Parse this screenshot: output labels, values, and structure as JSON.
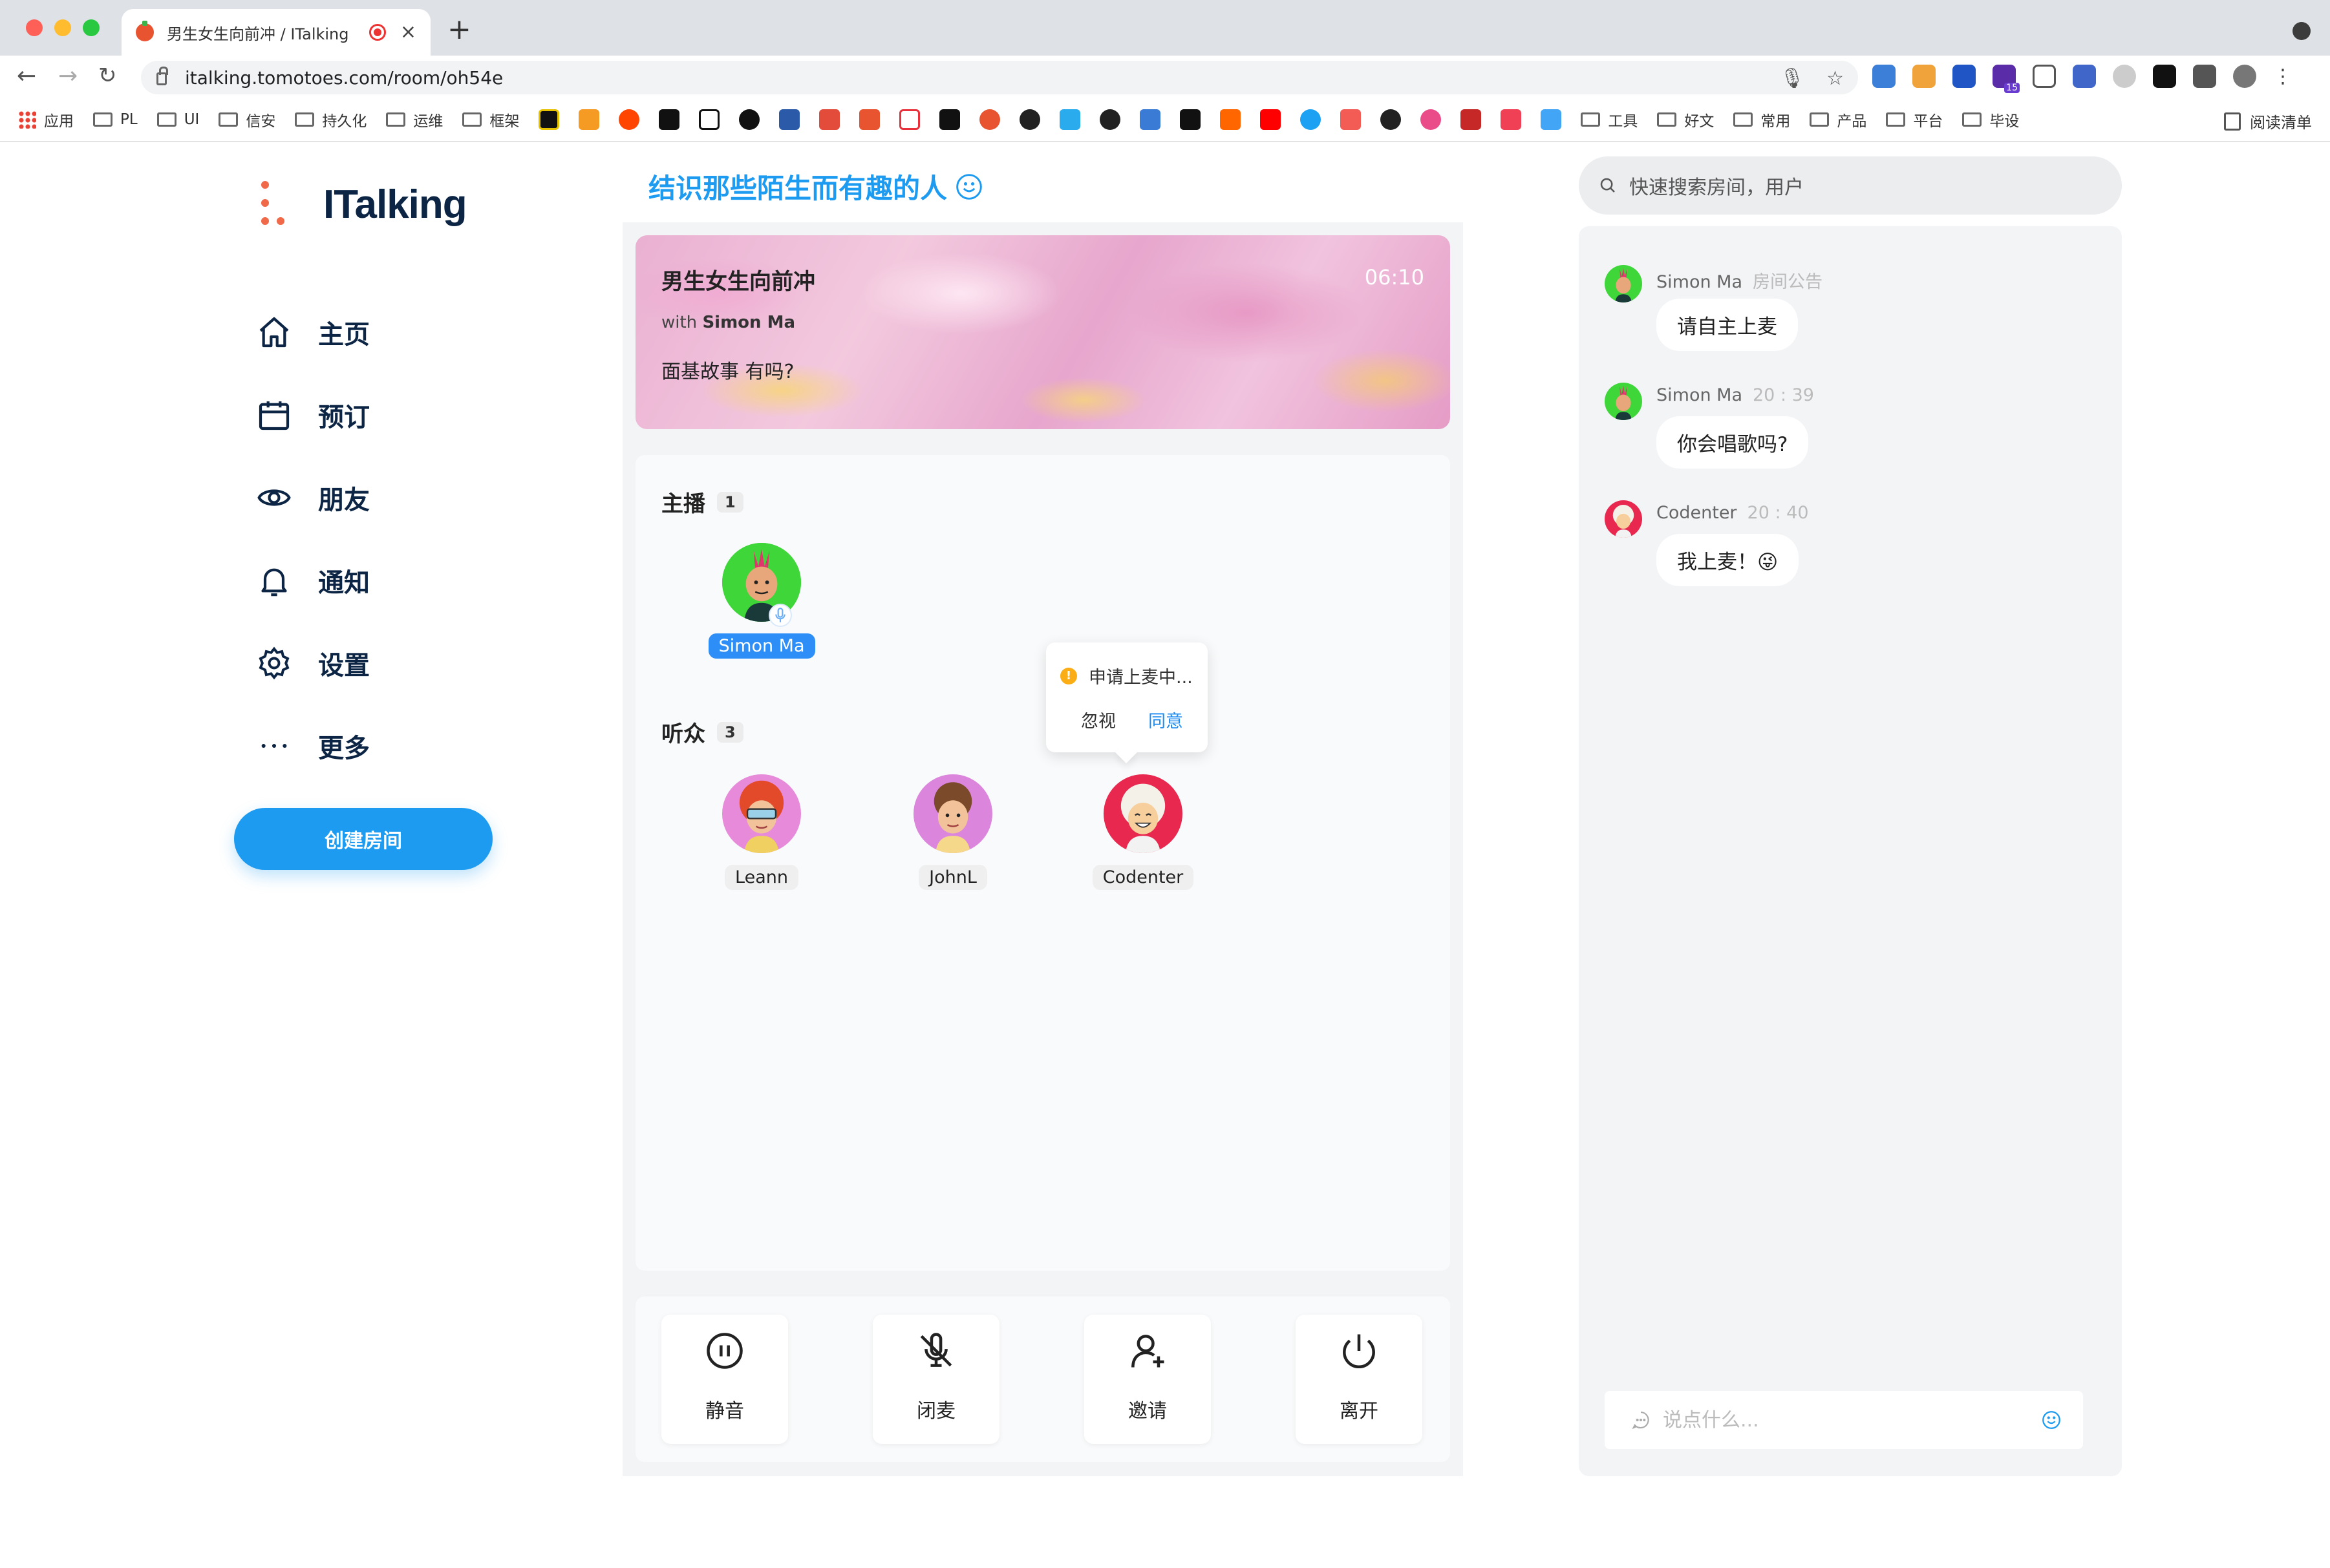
{
  "browser": {
    "tab_title": "男生女生向前冲 / ITalking",
    "url": "italking.tomotoes.com/room/oh54e",
    "bookmarks": [
      "应用",
      "PL",
      "UI",
      "信安",
      "持久化",
      "运维",
      "框架"
    ],
    "bookmarks_right": [
      "工具",
      "好文",
      "常用",
      "产品",
      "平台",
      "毕设"
    ],
    "reading_list": "阅读清单",
    "ext_badge": "15"
  },
  "app": {
    "logo": "ITalking",
    "nav": [
      {
        "label": "主页",
        "icon": "home-icon"
      },
      {
        "label": "预订",
        "icon": "calendar-icon"
      },
      {
        "label": "朋友",
        "icon": "eye-icon"
      },
      {
        "label": "通知",
        "icon": "bell-icon"
      },
      {
        "label": "设置",
        "icon": "gear-icon"
      },
      {
        "label": "更多",
        "icon": "more-icon"
      }
    ],
    "create_room": "创建房间",
    "accent": "#1d9bf0"
  },
  "room": {
    "header": "结识那些陌生而有趣的人",
    "title": "男生女生向前冲",
    "with_prefix": "with",
    "host_name": "Simon Ma",
    "topic": "面基故事 有吗?",
    "time": "06:10",
    "hosts_label": "主播",
    "hosts_count": "1",
    "listeners_label": "听众",
    "listeners_count": "3",
    "hosts": [
      {
        "name": "Simon Ma"
      }
    ],
    "listeners": [
      {
        "name": "Leann"
      },
      {
        "name": "JohnL"
      },
      {
        "name": "Codenter"
      }
    ]
  },
  "popover": {
    "message": "申请上麦中...",
    "ignore": "忽视",
    "agree": "同意"
  },
  "controls": [
    {
      "label": "静音",
      "icon": "pause-icon"
    },
    {
      "label": "闭麦",
      "icon": "mic-off-icon"
    },
    {
      "label": "邀请",
      "icon": "add-user-icon"
    },
    {
      "label": "离开",
      "icon": "power-icon"
    }
  ],
  "search": {
    "placeholder": "快速搜索房间，用户"
  },
  "chat": {
    "messages": [
      {
        "user": "Simon Ma",
        "meta": "房间公告",
        "text": "请自主上麦"
      },
      {
        "user": "Simon Ma",
        "meta": "20 : 39",
        "text": "你会唱歌吗?"
      },
      {
        "user": "Codenter",
        "meta": "20 : 40",
        "text": "我上麦！😜"
      }
    ],
    "input_placeholder": "说点什么..."
  }
}
